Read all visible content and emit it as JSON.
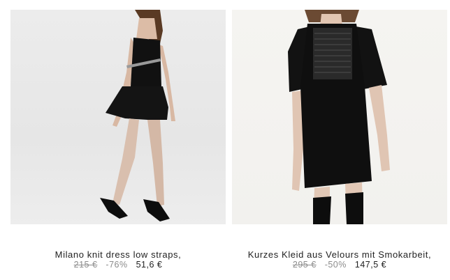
{
  "products": [
    {
      "title": "Milano knit dress low straps,",
      "old_price": "215 €",
      "discount": "-76%",
      "new_price": "51,6 €"
    },
    {
      "title": "Kurzes Kleid aus Velours mit Smokarbeit,",
      "old_price": "295 €",
      "discount": "-50%",
      "new_price": "147,5 €"
    }
  ]
}
